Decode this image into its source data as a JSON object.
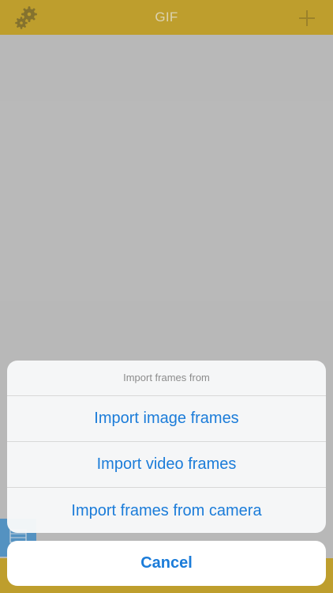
{
  "navbar": {
    "title": "GIF",
    "left_icon": "gear-icon",
    "right_icon": "plus-icon"
  },
  "action_sheet": {
    "title": "Import frames from",
    "items": [
      {
        "label": "Import image frames"
      },
      {
        "label": "Import video frames"
      },
      {
        "label": "Import frames from camera"
      }
    ],
    "cancel_label": "Cancel"
  },
  "colors": {
    "bar": "#d0a91f",
    "background": "#c9c9c9",
    "action_text": "#1b7cd9",
    "tab_accent": "#4f9ad3"
  }
}
